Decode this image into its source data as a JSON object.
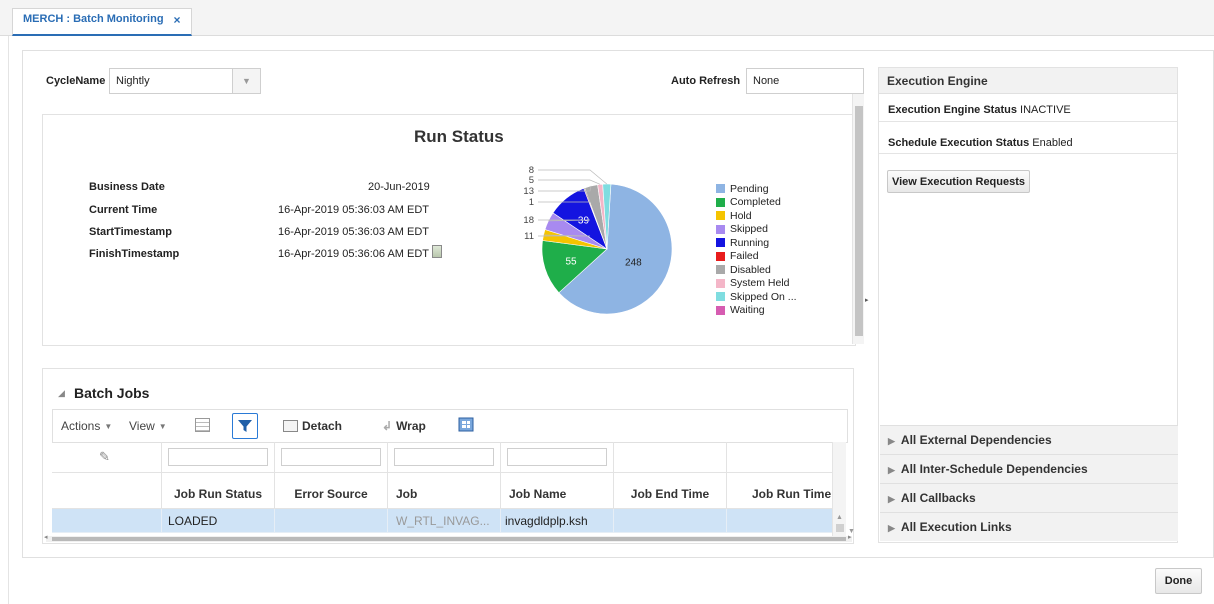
{
  "tab": {
    "title": "MERCH : Batch Monitoring",
    "close": "×"
  },
  "cycle": {
    "label": "CycleName",
    "value": "Nightly"
  },
  "auto_refresh": {
    "label": "Auto Refresh",
    "value": "None"
  },
  "run_status": {
    "title": "Run Status",
    "fields": [
      {
        "label": "Business Date",
        "value": "20-Jun-2019"
      },
      {
        "label": "Current Time",
        "value": "16-Apr-2019 05:36:03 AM EDT"
      },
      {
        "label": "StartTimestamp",
        "value": "16-Apr-2019 05:36:03 AM EDT"
      },
      {
        "label": "FinishTimestamp",
        "value": "16-Apr-2019 05:36:06 AM EDT"
      }
    ]
  },
  "chart_data": {
    "type": "pie",
    "categories": [
      "Pending",
      "Completed",
      "Hold",
      "Skipped",
      "Running",
      "Failed",
      "Disabled",
      "System Held",
      "Skipped On ...",
      "Waiting"
    ],
    "values": [
      248,
      55,
      11,
      18,
      39,
      1,
      13,
      5,
      8,
      0
    ],
    "colors": [
      "#8eb4e3",
      "#1fae4a",
      "#f5c400",
      "#a88af0",
      "#1414e0",
      "#e81c1c",
      "#a9a9a9",
      "#f4b6c8",
      "#7fdde0",
      "#d65cb1"
    ],
    "slice_labels_inside": [
      "248",
      "55",
      "",
      "",
      "39",
      "",
      "",
      "",
      "",
      ""
    ],
    "slice_labels_outside": [
      "",
      "",
      "11",
      "18",
      "",
      "1",
      "13",
      "5",
      "8",
      ""
    ],
    "legend_position": "right"
  },
  "batch_jobs": {
    "title": "Batch Jobs",
    "toolbar": {
      "actions": "Actions",
      "view": "View",
      "detach": "Detach",
      "wrap": "Wrap"
    },
    "columns": [
      "Job Run Status",
      "Error Source",
      "Job",
      "Job Name",
      "Job End Time",
      "Job Run Time"
    ],
    "rows": [
      {
        "job_run_status": "LOADED",
        "error_source": "",
        "job": "W_RTL_INVAG...",
        "job_name": "invagdldplp.ksh",
        "job_end_time": "",
        "job_run_time": ""
      }
    ]
  },
  "execution_engine": {
    "title": "Execution Engine",
    "status_label": "Execution Engine Status",
    "status_value": "INACTIVE",
    "schedule_label": "Schedule Execution Status",
    "schedule_value": "Enabled",
    "view_requests": "View Execution Requests",
    "sections": [
      "All External Dependencies",
      "All Inter-Schedule Dependencies",
      "All Callbacks",
      "All Execution Links"
    ]
  },
  "done": "Done",
  "icons": [
    "close-icon",
    "dropdown-arrow-icon",
    "collapse-triangle-icon",
    "calendar-icon",
    "filter-icon",
    "detach-icon",
    "wrap-icon",
    "freeze-icon",
    "edit-pencil-icon",
    "expand-triangle-icon",
    "splitter-arrow-icon"
  ]
}
